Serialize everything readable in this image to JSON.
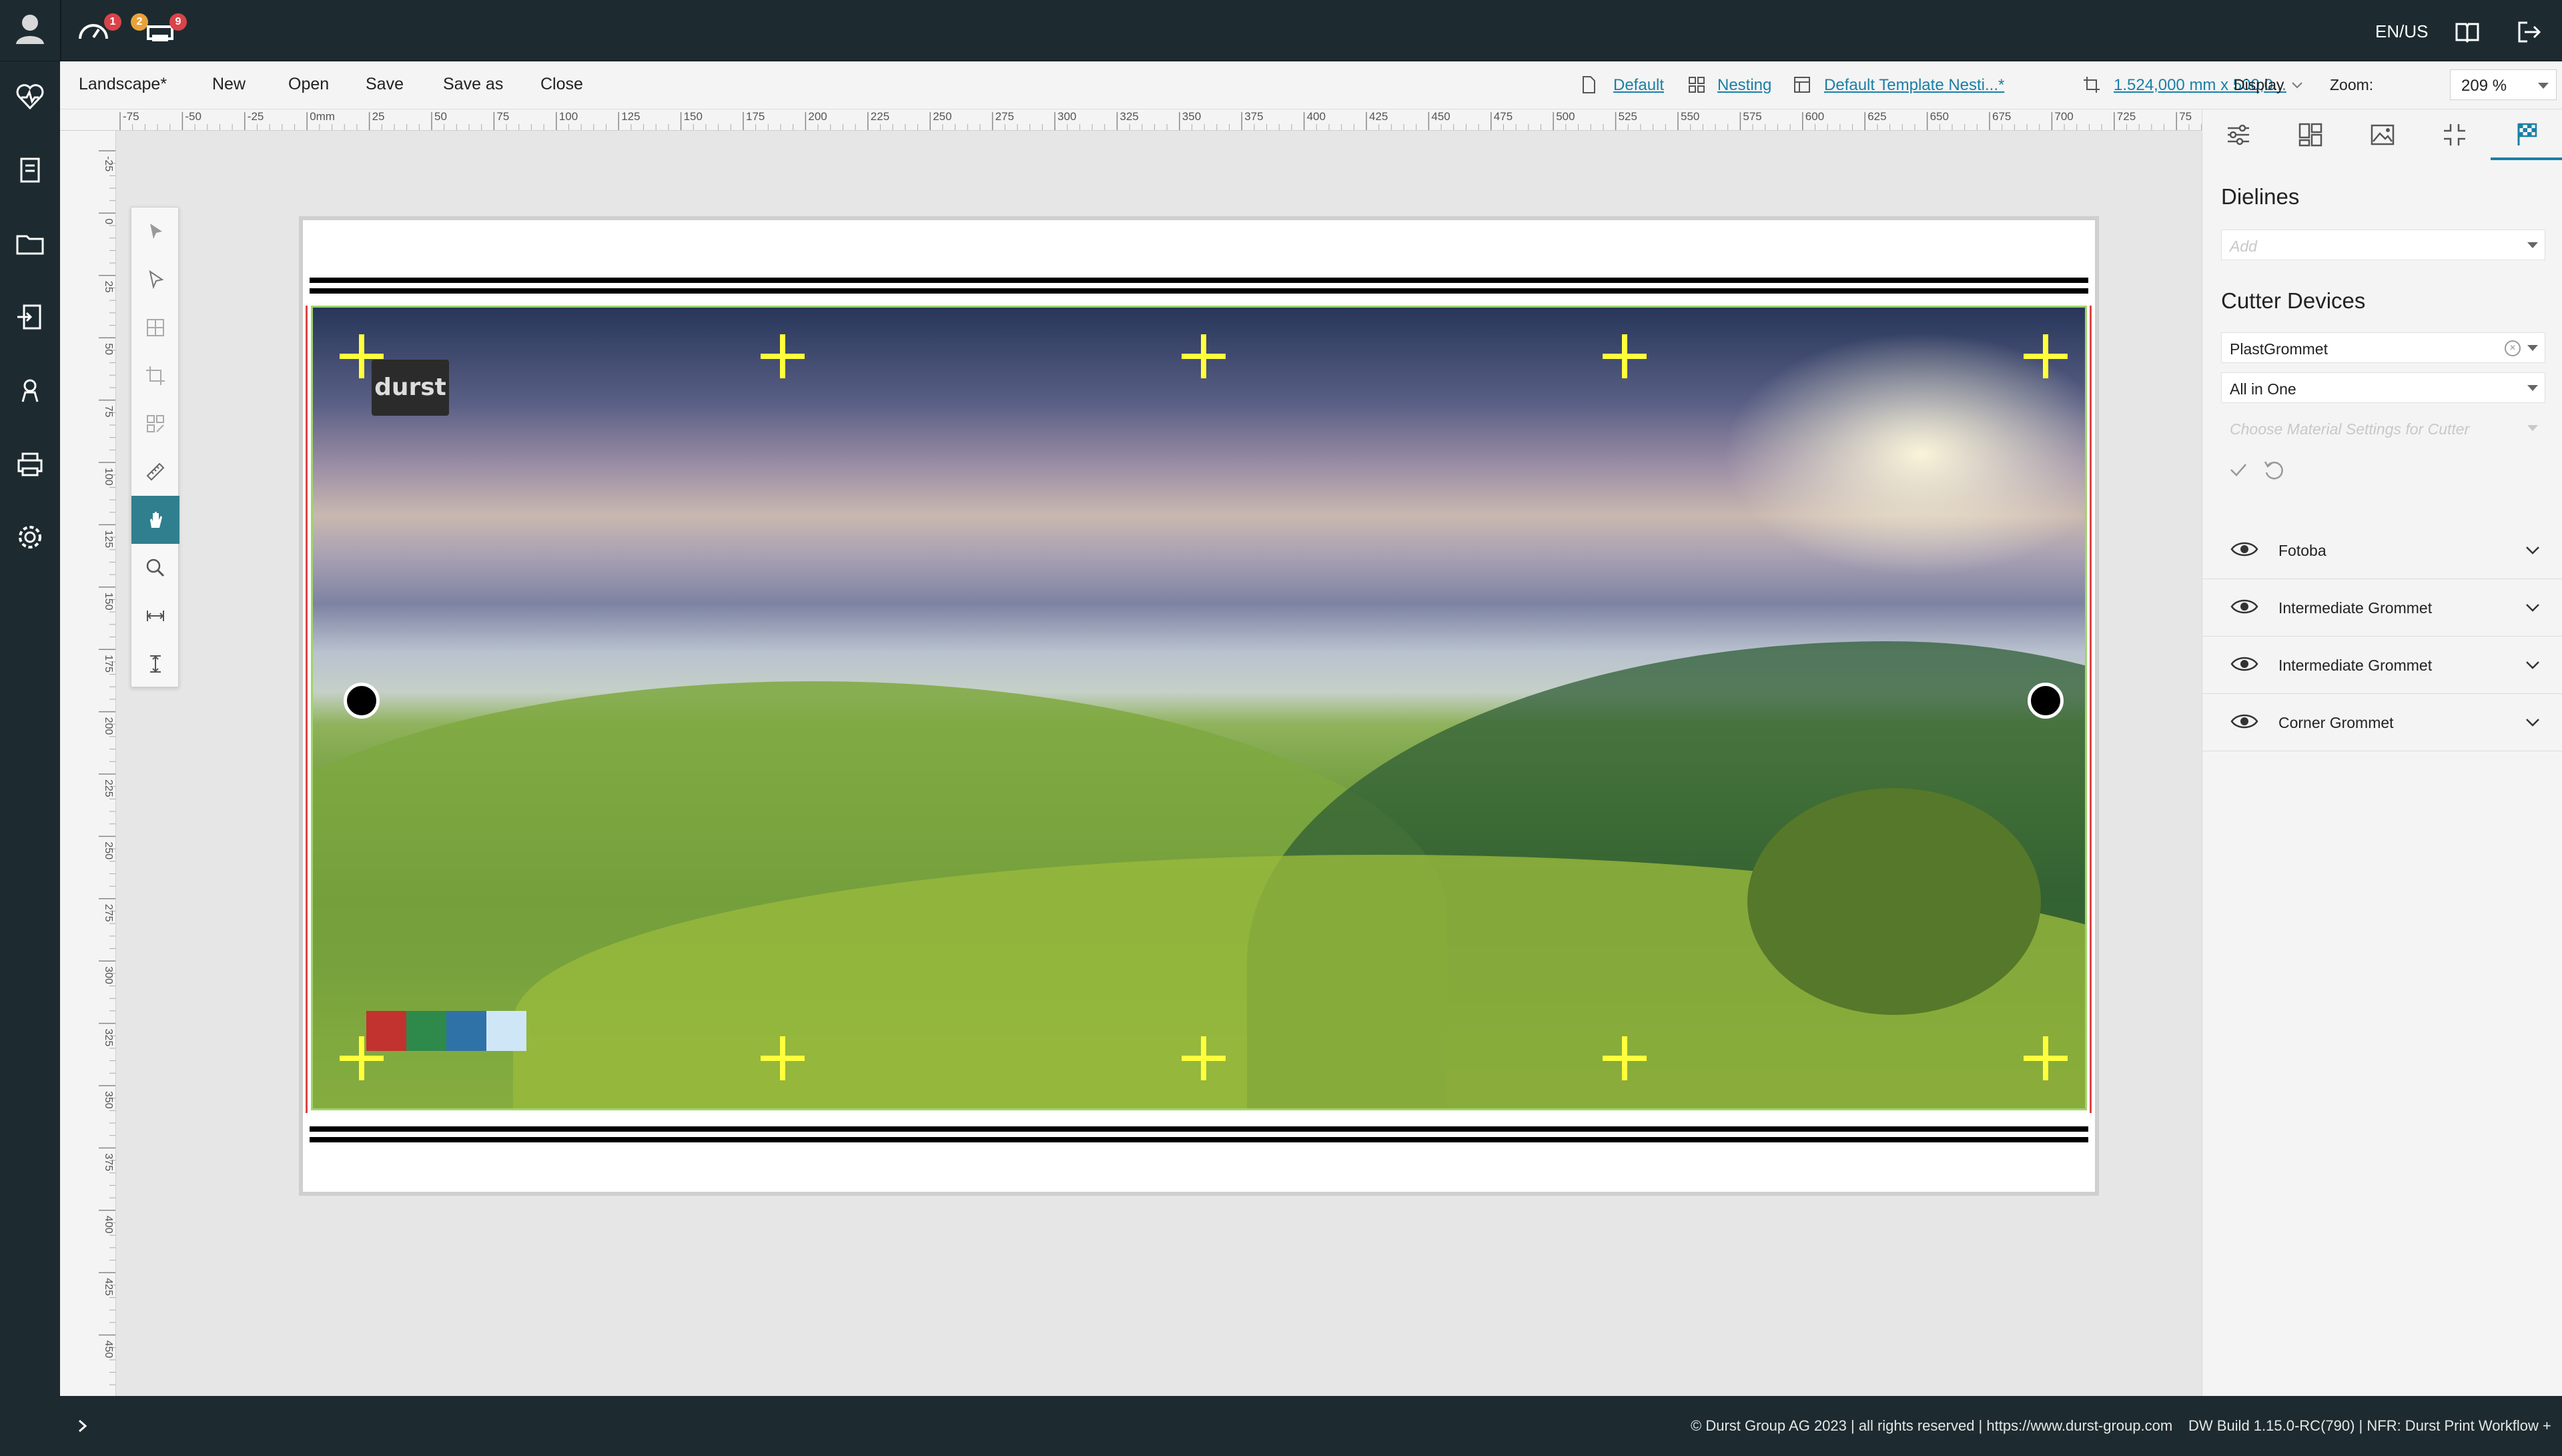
{
  "topbar": {
    "badges": {
      "dashboard": "1",
      "alerts": "2",
      "printers": "9"
    },
    "language": "EN/US",
    "colors": {
      "badge_red": "#d9434a",
      "badge_orange": "#e8a23a"
    }
  },
  "menubar": {
    "document_title": "Landscape*",
    "items": [
      "New",
      "Open",
      "Save",
      "Save as",
      "Close"
    ],
    "profile_link": "Default",
    "nesting_link": "Nesting",
    "template_link": "Default Template Nesti...*",
    "size_link": "1.524,000 mm x 500,0...",
    "display_label": "Display",
    "zoom_label": "Zoom:",
    "zoom_value": "209 %"
  },
  "ruler": {
    "h_ticks": [
      "-75",
      "-50",
      "-25",
      "0mm",
      "25",
      "50",
      "75",
      "100",
      "125",
      "150",
      "175",
      "200",
      "225",
      "250",
      "275",
      "300",
      "325",
      "350",
      "375",
      "400",
      "425",
      "450",
      "475",
      "500",
      "525",
      "550",
      "575",
      "600",
      "625",
      "650",
      "675",
      "700",
      "725",
      "75"
    ],
    "v_ticks": [
      "-25",
      "0",
      "25",
      "50",
      "75",
      "100",
      "125",
      "150",
      "175",
      "200",
      "225",
      "250",
      "275",
      "300",
      "325",
      "350",
      "375",
      "400",
      "425",
      "450"
    ]
  },
  "canvas": {
    "logo_text": "durst",
    "accent_color": "#2f7f8f",
    "crosshair_color": "#ffff3c",
    "swatch_colors": [
      "#c2322f",
      "#2e8a4a",
      "#2f72a8",
      "#cfe6f7"
    ]
  },
  "toolbox": {
    "tools": [
      "select-icon",
      "direct-select-icon",
      "grid-icon",
      "crop-icon",
      "transform-icon",
      "ruler-icon",
      "hand-icon",
      "zoom-icon",
      "measure-width-icon",
      "measure-height-icon"
    ],
    "active_tool": "hand-icon"
  },
  "right_panel": {
    "tabs": [
      "properties-tab",
      "layout-tab",
      "image-tab",
      "fit-tab",
      "cutter-tab"
    ],
    "dielines_title": "Dielines",
    "dielines_placeholder": "Add",
    "cutter_title": "Cutter Devices",
    "cutter_device": "PlastGrommet",
    "cutter_mode": "All in One",
    "material_placeholder": "Choose Material Settings for Cutter",
    "layers": [
      {
        "label": "Fotoba"
      },
      {
        "label": "Intermediate Grommet"
      },
      {
        "label": "Intermediate Grommet"
      },
      {
        "label": "Corner Grommet"
      }
    ]
  },
  "footer": {
    "copyright": "© Durst Group AG 2023 | all rights reserved | https://www.durst-group.com",
    "build": "DW Build 1.15.0-RC(790)  |  NFR: Durst Print Workflow +"
  }
}
